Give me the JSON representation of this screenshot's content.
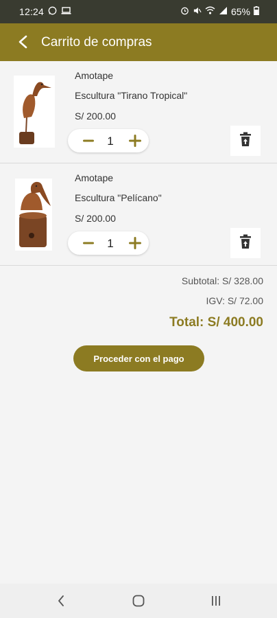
{
  "status_bar": {
    "time": "12:24",
    "battery": "65%"
  },
  "app_bar": {
    "title": "Carrito de compras"
  },
  "cart": {
    "items": [
      {
        "brand": "Amotape",
        "name": "Escultura \"Tirano Tropical\"",
        "price": "S/ 200.00",
        "quantity": "1"
      },
      {
        "brand": "Amotape",
        "name": "Escultura \"Pelícano\"",
        "price": "S/ 200.00",
        "quantity": "1"
      }
    ]
  },
  "summary": {
    "subtotal": "Subtotal: S/ 328.00",
    "igv": "IGV: S/ 72.00",
    "total": "Total: S/ 400.00"
  },
  "checkout": {
    "button_label": "Proceder con el pago"
  },
  "colors": {
    "accent": "#8c7b22",
    "status_bar": "#393b30",
    "background": "#f4f4f4"
  }
}
